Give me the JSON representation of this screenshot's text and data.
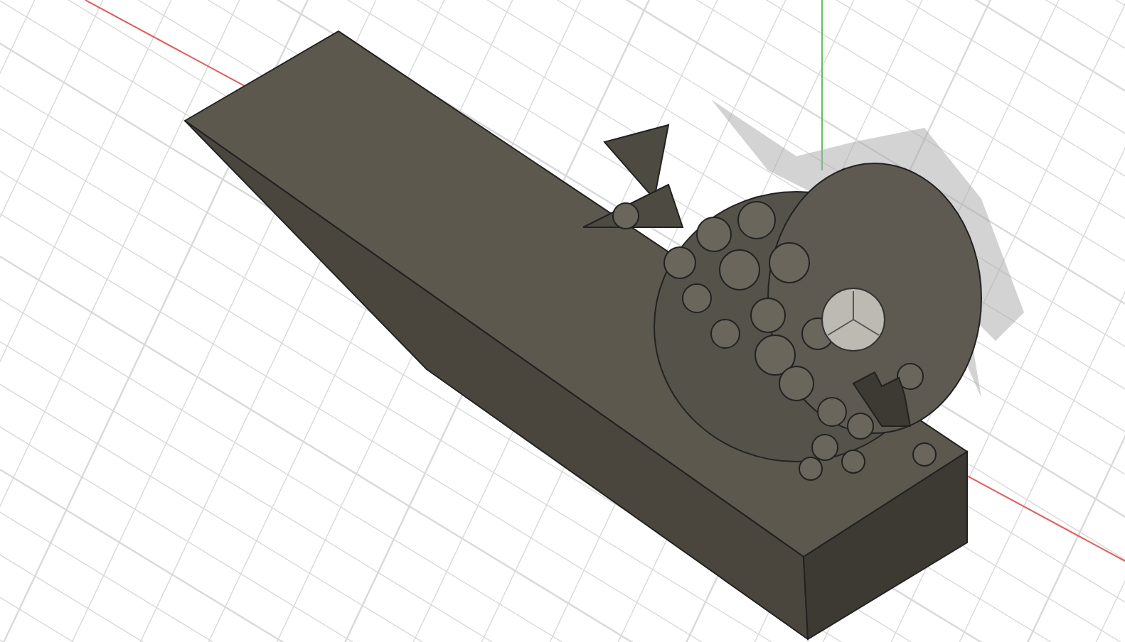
{
  "scene": {
    "kind": "cad-viewport"
  }
}
